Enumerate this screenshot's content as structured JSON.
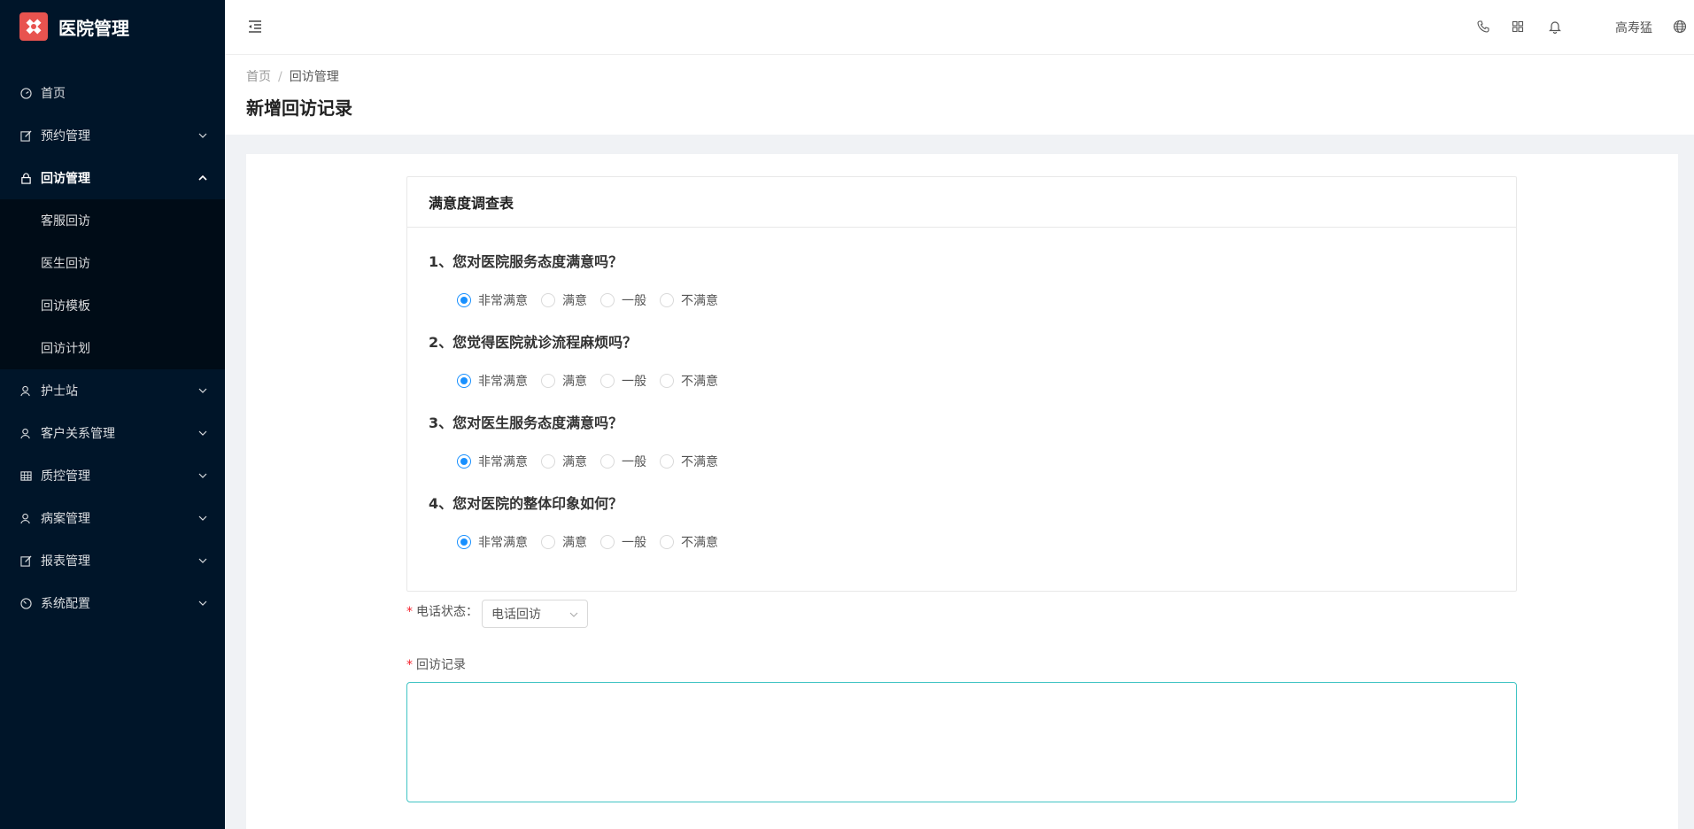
{
  "app": {
    "title": "医院管理"
  },
  "sidebar": {
    "items": [
      {
        "label": "首页",
        "icon": "dashboard-icon"
      },
      {
        "label": "预约管理",
        "icon": "edit-icon",
        "expandable": true
      },
      {
        "label": "回访管理",
        "icon": "lock-icon",
        "expandable": true,
        "expanded": true,
        "children": [
          {
            "label": "客服回访"
          },
          {
            "label": "医生回访"
          },
          {
            "label": "回访模板"
          },
          {
            "label": "回访计划"
          }
        ]
      },
      {
        "label": "护士站",
        "icon": "user-icon",
        "expandable": true
      },
      {
        "label": "客户关系管理",
        "icon": "user-icon",
        "expandable": true
      },
      {
        "label": "质控管理",
        "icon": "table-icon",
        "expandable": true
      },
      {
        "label": "病案管理",
        "icon": "user-icon",
        "expandable": true
      },
      {
        "label": "报表管理",
        "icon": "edit-icon",
        "expandable": true
      },
      {
        "label": "系统配置",
        "icon": "gauge-icon",
        "expandable": true
      }
    ]
  },
  "header": {
    "user_name": "高寿猛",
    "icons": [
      "menu-fold-icon",
      "phone-icon",
      "apps-icon",
      "bell-icon",
      "globe-icon"
    ]
  },
  "breadcrumb": {
    "home": "首页",
    "separator": "/",
    "current": "回访管理"
  },
  "page_title": "新增回访记录",
  "survey": {
    "title": "满意度调查表",
    "options": [
      "非常满意",
      "满意",
      "一般",
      "不满意"
    ],
    "questions": [
      {
        "text": "1、您对医院服务态度满意吗？",
        "selected": "非常满意"
      },
      {
        "text": "2、您觉得医院就诊流程麻烦吗？",
        "selected": "非常满意"
      },
      {
        "text": "3、您对医生服务态度满意吗？",
        "selected": "非常满意"
      },
      {
        "text": "4、您对医院的整体印象如何？",
        "selected": "非常满意"
      }
    ]
  },
  "form": {
    "required_mark": "*",
    "phone_status_label": "电话状态：",
    "phone_status_value": "电话回访",
    "record_label": "回访记录",
    "record_value": ""
  },
  "colors": {
    "sidebar_bg": "#001529",
    "submenu_bg": "#000c17",
    "primary": "#1890ff",
    "logo": "#e8534f",
    "required": "#f5222d"
  }
}
